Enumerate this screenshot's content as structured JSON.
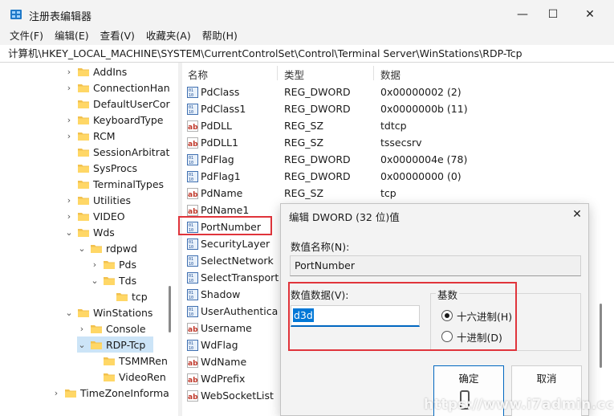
{
  "window": {
    "title": "注册表编辑器",
    "min_glyph": "—",
    "max_glyph": "☐",
    "close_glyph": "✕"
  },
  "menu": [
    "文件(F)",
    "编辑(E)",
    "查看(V)",
    "收藏夹(A)",
    "帮助(H)"
  ],
  "address": "计算机\\HKEY_LOCAL_MACHINE\\SYSTEM\\CurrentControlSet\\Control\\Terminal Server\\WinStations\\RDP-Tcp",
  "tree": [
    {
      "label": "AddIns",
      "level": 0,
      "chevron": ">",
      "selected": false
    },
    {
      "label": "ConnectionHan",
      "level": 0,
      "chevron": ">",
      "selected": false
    },
    {
      "label": "DefaultUserCor",
      "level": 0,
      "chevron": "",
      "selected": false
    },
    {
      "label": "KeyboardType",
      "level": 0,
      "chevron": ">",
      "selected": false
    },
    {
      "label": "RCM",
      "level": 0,
      "chevron": ">",
      "selected": false
    },
    {
      "label": "SessionArbitrat",
      "level": 0,
      "chevron": "",
      "selected": false
    },
    {
      "label": "SysProcs",
      "level": 0,
      "chevron": "",
      "selected": false
    },
    {
      "label": "TerminalTypes",
      "level": 0,
      "chevron": "",
      "selected": false
    },
    {
      "label": "Utilities",
      "level": 0,
      "chevron": ">",
      "selected": false
    },
    {
      "label": "VIDEO",
      "level": 0,
      "chevron": ">",
      "selected": false
    },
    {
      "label": "Wds",
      "level": 0,
      "chevron": "v",
      "selected": false
    },
    {
      "label": "rdpwd",
      "level": 1,
      "chevron": "v",
      "selected": false
    },
    {
      "label": "Pds",
      "level": 2,
      "chevron": ">",
      "selected": false
    },
    {
      "label": "Tds",
      "level": 2,
      "chevron": "v",
      "selected": false
    },
    {
      "label": "tcp",
      "level": 3,
      "chevron": "",
      "selected": false
    },
    {
      "label": "WinStations",
      "level": 0,
      "chevron": "v",
      "selected": false
    },
    {
      "label": "Console",
      "level": 1,
      "chevron": ">",
      "selected": false
    },
    {
      "label": "RDP-Tcp",
      "level": 1,
      "chevron": "v",
      "selected": true
    },
    {
      "label": "TSMMRen",
      "level": 2,
      "chevron": "",
      "selected": false
    },
    {
      "label": "VideoRen",
      "level": 2,
      "chevron": "",
      "selected": false
    },
    {
      "label": "TimeZoneInforma",
      "level": -1,
      "chevron": ">",
      "selected": false
    }
  ],
  "columns": {
    "name": "名称",
    "type": "类型",
    "data": "数据"
  },
  "values": [
    {
      "name": "PdClass",
      "type": "REG_DWORD",
      "data": "0x00000002 (2)",
      "icon": "dword"
    },
    {
      "name": "PdClass1",
      "type": "REG_DWORD",
      "data": "0x0000000b (11)",
      "icon": "dword"
    },
    {
      "name": "PdDLL",
      "type": "REG_SZ",
      "data": "tdtcp",
      "icon": "sz"
    },
    {
      "name": "PdDLL1",
      "type": "REG_SZ",
      "data": "tssecsrv",
      "icon": "sz"
    },
    {
      "name": "PdFlag",
      "type": "REG_DWORD",
      "data": "0x0000004e (78)",
      "icon": "dword"
    },
    {
      "name": "PdFlag1",
      "type": "REG_DWORD",
      "data": "0x00000000 (0)",
      "icon": "dword"
    },
    {
      "name": "PdName",
      "type": "REG_SZ",
      "data": "tcp",
      "icon": "sz"
    },
    {
      "name": "PdName1",
      "type": "",
      "data": "",
      "icon": "sz"
    },
    {
      "name": "PortNumber",
      "type": "",
      "data": "",
      "icon": "dword"
    },
    {
      "name": "SecurityLayer",
      "type": "",
      "data": "",
      "icon": "dword"
    },
    {
      "name": "SelectNetwork",
      "type": "",
      "data": "",
      "icon": "dword"
    },
    {
      "name": "SelectTransport",
      "type": "",
      "data": "",
      "icon": "dword"
    },
    {
      "name": "Shadow",
      "type": "",
      "data": "",
      "icon": "dword"
    },
    {
      "name": "UserAuthentica",
      "type": "",
      "data": "",
      "icon": "dword"
    },
    {
      "name": "Username",
      "type": "",
      "data": "",
      "icon": "sz"
    },
    {
      "name": "WdFlag",
      "type": "",
      "data": "",
      "icon": "dword"
    },
    {
      "name": "WdName",
      "type": "",
      "data": "",
      "icon": "sz"
    },
    {
      "name": "WdPrefix",
      "type": "",
      "data": "",
      "icon": "sz"
    },
    {
      "name": "WebSocketList",
      "type": "",
      "data": "",
      "icon": "sz"
    }
  ],
  "dialog": {
    "title": "编辑 DWORD (32 位)值",
    "close_glyph": "✕",
    "name_label": "数值名称(N):",
    "name_value": "PortNumber",
    "data_label": "数值数据(V):",
    "data_value": "d3d",
    "base_label": "基数",
    "hex_label": "十六进制(H)",
    "dec_label": "十进制(D)",
    "ok_label": "确定",
    "cancel_label": "取消"
  },
  "watermark": "https://www.i7admin.cc",
  "colors": {
    "highlight": "#e0343b",
    "selection": "#cce4f7",
    "accent": "#0067c0"
  }
}
